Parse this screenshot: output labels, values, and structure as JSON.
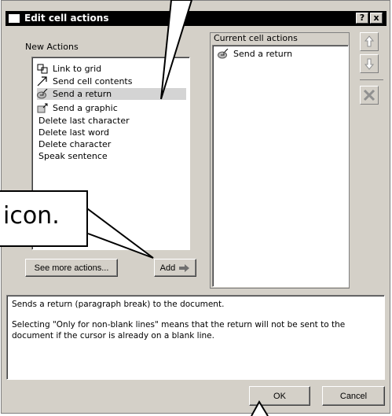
{
  "window": {
    "title": "Edit cell actions",
    "help_label": "?",
    "close_label": "x"
  },
  "new_actions": {
    "heading": "New Actions",
    "items": [
      {
        "label": "Link to grid",
        "icon": "grid-link-icon"
      },
      {
        "label": "Send cell contents",
        "icon": "arrow-icon"
      },
      {
        "label": "Send a return",
        "icon": "return-icon",
        "selected": true
      },
      {
        "label": "Send a graphic",
        "icon": "graphic-icon"
      },
      {
        "label": "Delete last character"
      },
      {
        "label": "Delete last word"
      },
      {
        "label": "Delete character"
      },
      {
        "label": "Speak sentence"
      }
    ]
  },
  "current_actions": {
    "heading": "Current cell actions",
    "items": [
      {
        "label": "Send a return",
        "icon": "return-icon"
      }
    ]
  },
  "buttons": {
    "see_more": "See more actions...",
    "add": "Add",
    "ok": "OK",
    "cancel": "Cancel"
  },
  "description": {
    "line1": "Sends a return (paragraph break) to the document.",
    "line2": "Selecting \"Only for non-blank lines\" means that the return will not be sent to the document if the cursor is already on a blank line."
  },
  "callout": {
    "text": "icon."
  },
  "colors": {
    "dialog_bg": "#d4d0c8",
    "title_bg": "#000000",
    "selected_bg": "#d4d4d4",
    "disabled_icon": "#808080"
  }
}
